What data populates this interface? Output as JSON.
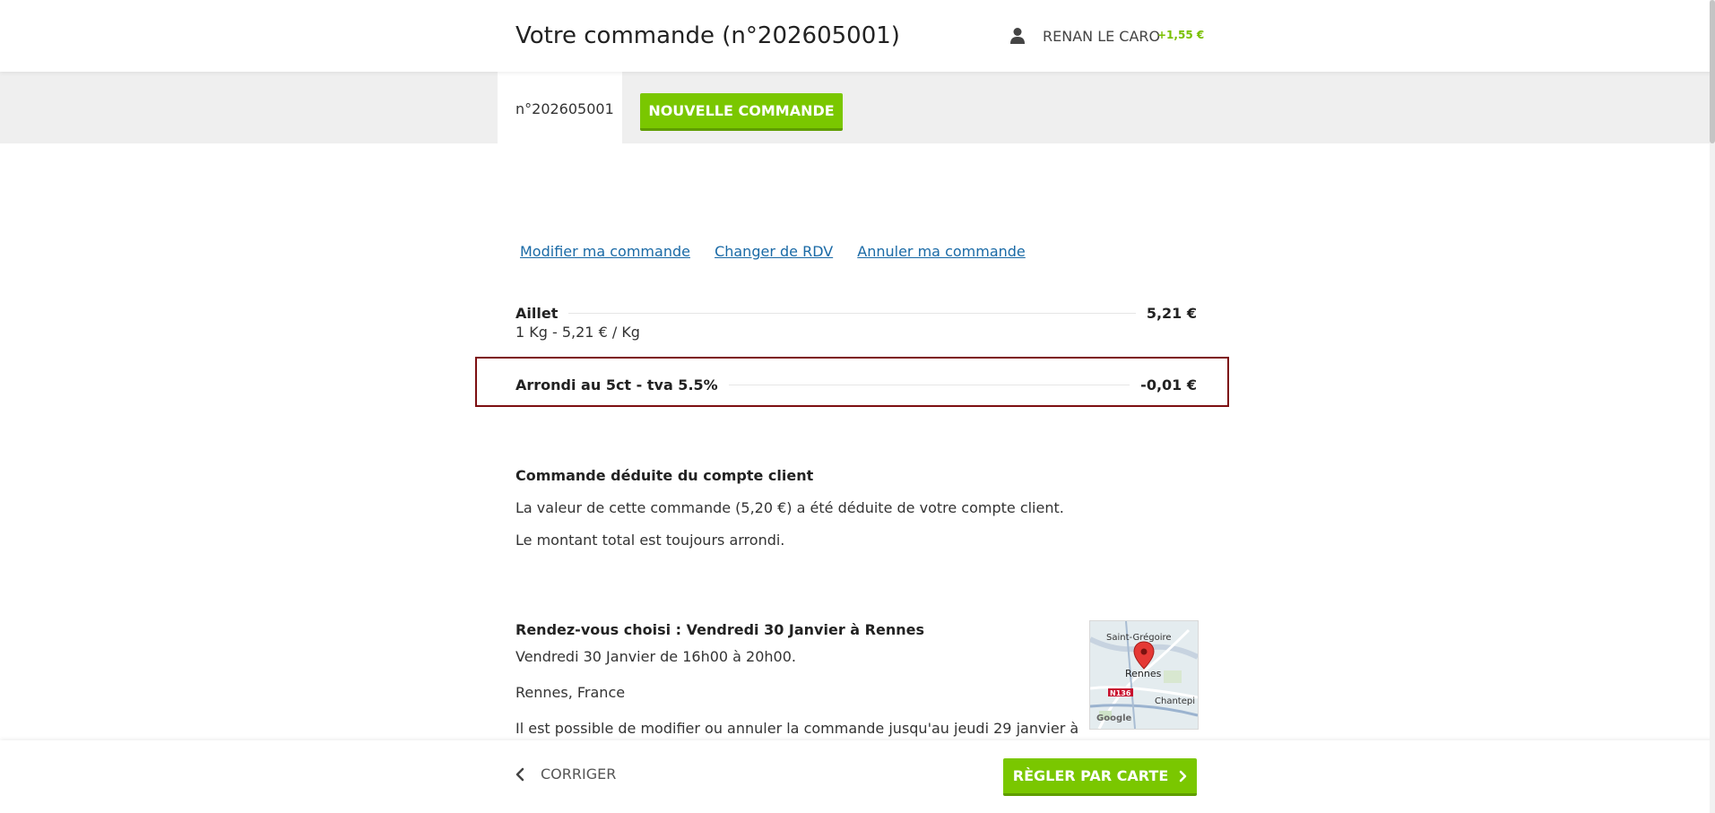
{
  "header": {
    "title": "Votre commande (n°202605001)",
    "user_icon": "user-icon",
    "user_name": "RENAN LE CARO",
    "user_credit": "+1,55 €"
  },
  "tabs": {
    "active_tab": "n°202605001",
    "new_order_label": "NOUVELLE COMMANDE"
  },
  "actions": {
    "modify": "Modifier ma commande",
    "change_rdv": "Changer de RDV",
    "cancel": "Annuler ma commande"
  },
  "items": [
    {
      "name": "Aillet",
      "price": "5,21 €",
      "detail": "1 Kg - 5,21 € / Kg"
    },
    {
      "name": "Arrondi au 5ct - tva 5.5%",
      "price": "-0,01 €"
    }
  ],
  "account_section": {
    "title": "Commande déduite du compte client",
    "line1": "La valeur de cette commande (5,20 €) a été déduite de votre compte client.",
    "line2": "Le montant total est toujours arrondi."
  },
  "rdv_section": {
    "title": "Rendez-vous choisi : Vendredi 30 Janvier à Rennes",
    "time": "Vendredi 30 Janvier de 16h00 à 20h00.",
    "place": "Rennes, France",
    "note": "Il est possible de modifier ou annuler la commande jusqu'au jeudi 29 janvier à"
  },
  "map": {
    "label_top": "Saint-Grégoire",
    "label_city": "Rennes",
    "label_right": "Chantepi",
    "road": "N136",
    "brand": "Google"
  },
  "footer": {
    "back_label": "CORRIGER",
    "pay_label": "RÈGLER PAR CARTE"
  },
  "colors": {
    "accent": "#7ac700",
    "credit": "#79c000",
    "link": "#1a6aa6",
    "highlight_border": "#7d0f12"
  }
}
